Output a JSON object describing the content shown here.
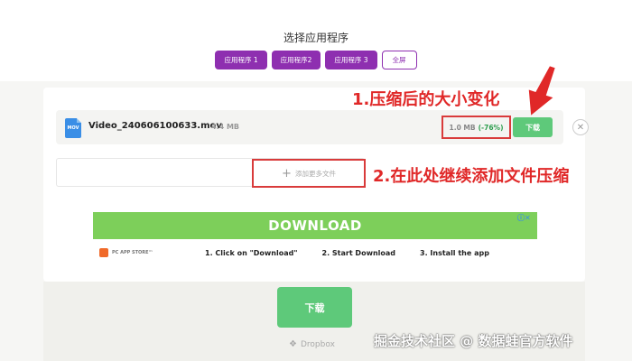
{
  "header": {
    "title": "选择应用程序",
    "apps": [
      {
        "label": "应用程序 1"
      },
      {
        "label": "应用程序2"
      },
      {
        "label": "应用程序 3"
      }
    ],
    "fullscreen_label": "全屏"
  },
  "file": {
    "icon_text": "MOV",
    "name": "Video_240606100633.mov",
    "original_size": "4.4 MB",
    "new_size": "1.0 MB",
    "reduction": "(-76%)",
    "download_label": "下载"
  },
  "add_more": {
    "label": "添加更多文件"
  },
  "annotations": {
    "note1": "1.压缩后的大小变化",
    "note2": "2.在此处继续添加文件压缩"
  },
  "ad": {
    "banner": "DOWNLOAD",
    "store_label": "PC APP STORE™",
    "steps": [
      "1. Click on \"Download\"",
      "2. Start Download",
      "3. Install the app"
    ],
    "close": "ⓘ✕"
  },
  "main_download": {
    "label": "下载"
  },
  "dropbox": {
    "label": "Dropbox"
  },
  "watermark": "掘金技术社区 @ 数据蛙官方软件",
  "colors": {
    "purple": "#8e2fb0",
    "green": "#5ec97a",
    "red": "#d93b3b",
    "ad_green": "#7dcf5a"
  }
}
